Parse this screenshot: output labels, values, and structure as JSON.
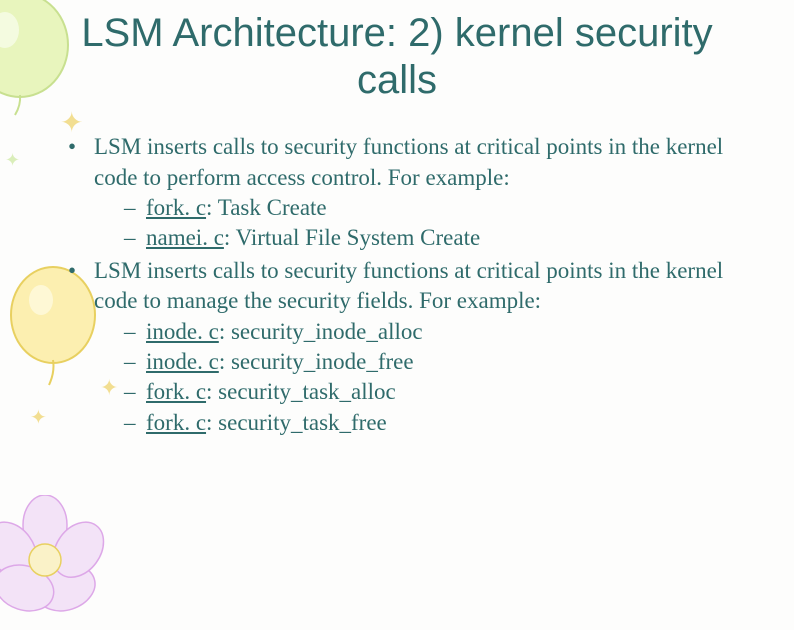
{
  "title": "LSM Architecture: 2) kernel security calls",
  "bullets": [
    {
      "text": "LSM inserts calls to security functions at critical points in the kernel code to perform access control. For example:",
      "sub": [
        {
          "file": "fork. c",
          "desc": ": Task Create"
        },
        {
          "file": "namei. c",
          "desc": ": Virtual File System Create"
        }
      ]
    },
    {
      "text": "LSM inserts calls to security functions at critical points in the kernel code to manage the security fields. For example:",
      "sub": [
        {
          "file": "inode. c",
          "desc": ": security_inode_alloc"
        },
        {
          "file": "inode. c",
          "desc": ": security_inode_free"
        },
        {
          "file": "fork. c",
          "desc": ": security_task_alloc"
        },
        {
          "file": "fork. c",
          "desc": ": security_task_free"
        }
      ]
    }
  ]
}
